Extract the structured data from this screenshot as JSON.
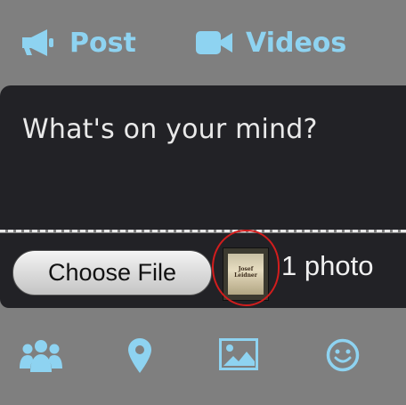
{
  "tabs": {
    "post_label": "Post",
    "videos_label": "Videos"
  },
  "composer": {
    "placeholder": "What's on your mind?"
  },
  "attach": {
    "choose_file_label": "Choose File",
    "photo_count": "1 photo",
    "thumbnail_caption": "Josef Leidner"
  },
  "bottom_toolbar": {
    "icons": [
      "people-icon",
      "location-pin-icon",
      "image-icon",
      "smiley-icon"
    ]
  },
  "colors": {
    "accent": "#8ed3f1",
    "background": "#7f7f7f",
    "panel": "#222226",
    "highlight": "#d21d1d"
  }
}
